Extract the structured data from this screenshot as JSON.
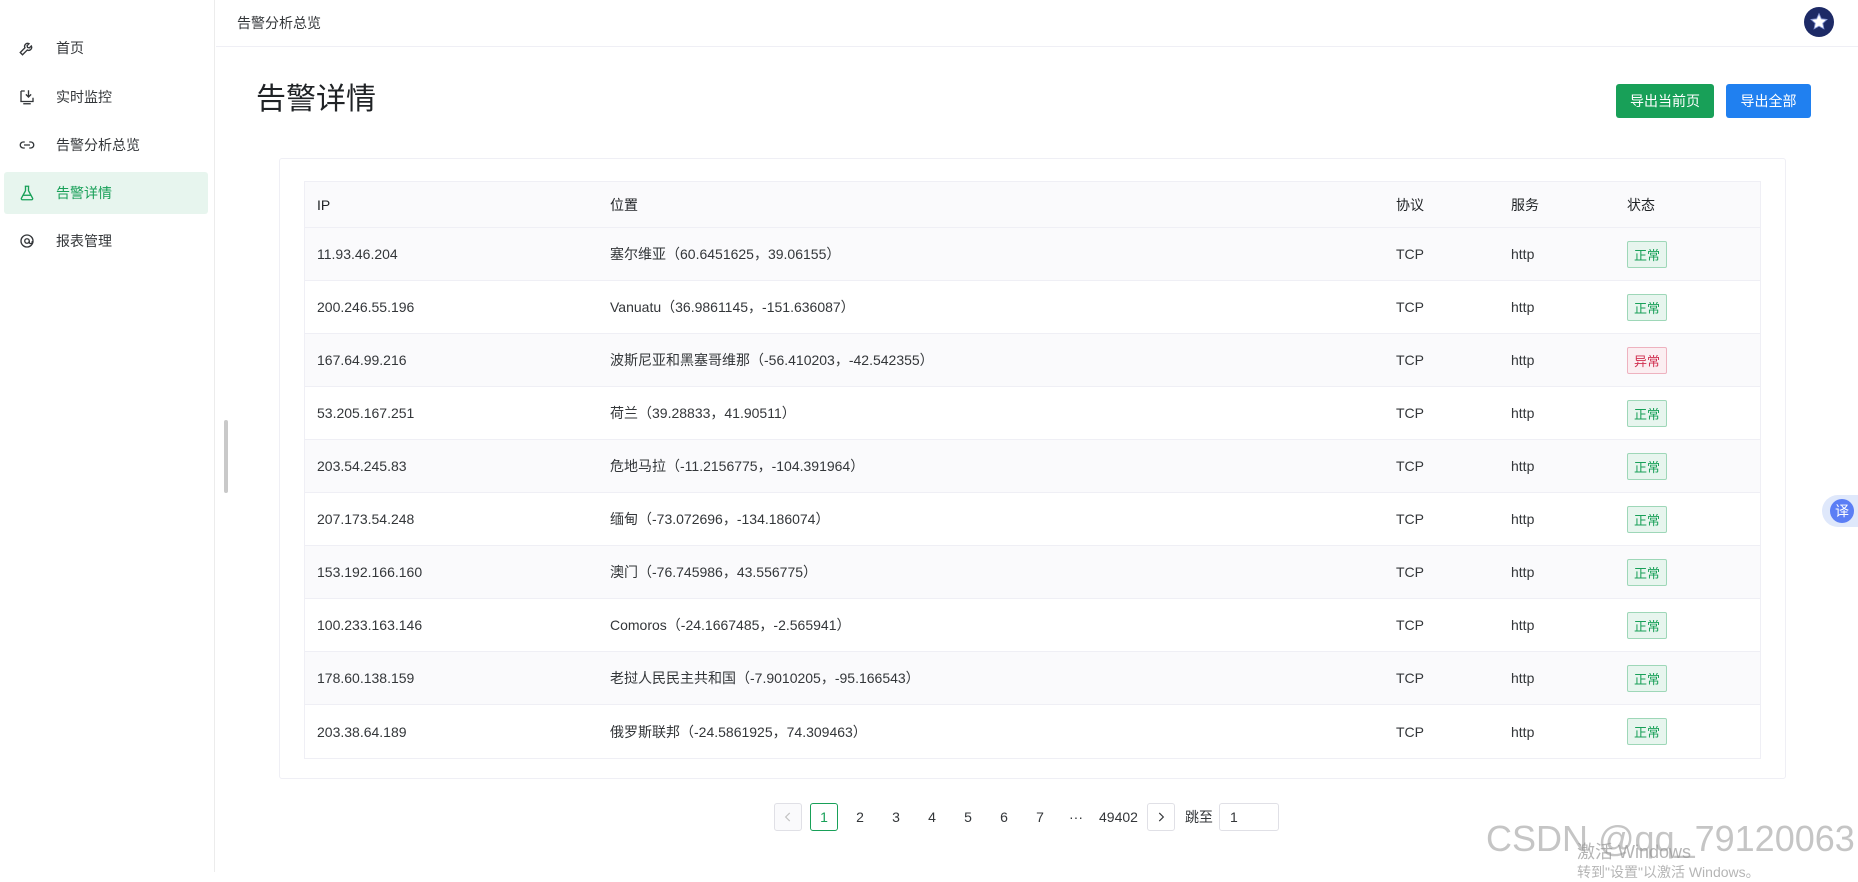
{
  "sidebar": {
    "items": [
      {
        "label": "首页",
        "icon": "wrench-icon"
      },
      {
        "label": "实时监控",
        "icon": "download-monitor-icon"
      },
      {
        "label": "告警分析总览",
        "icon": "link-icon"
      },
      {
        "label": "告警详情",
        "icon": "flask-icon",
        "active": true
      },
      {
        "label": "报表管理",
        "icon": "search-at-icon"
      }
    ]
  },
  "header": {
    "breadcrumb": "告警分析总览"
  },
  "page": {
    "title": "告警详情",
    "export_current_label": "导出当前页",
    "export_all_label": "导出全部"
  },
  "table": {
    "columns": [
      "IP",
      "位置",
      "协议",
      "服务",
      "状态"
    ],
    "rows": [
      {
        "ip": "11.93.46.204",
        "location": "塞尔维亚（60.6451625，39.06155）",
        "protocol": "TCP",
        "service": "http",
        "status": "正常",
        "status_type": "ok"
      },
      {
        "ip": "200.246.55.196",
        "location": "Vanuatu（36.9861145，-151.636087）",
        "protocol": "TCP",
        "service": "http",
        "status": "正常",
        "status_type": "ok"
      },
      {
        "ip": "167.64.99.216",
        "location": "波斯尼亚和黑塞哥维那（-56.410203，-42.542355）",
        "protocol": "TCP",
        "service": "http",
        "status": "异常",
        "status_type": "err"
      },
      {
        "ip": "53.205.167.251",
        "location": "荷兰（39.28833，41.90511）",
        "protocol": "TCP",
        "service": "http",
        "status": "正常",
        "status_type": "ok"
      },
      {
        "ip": "203.54.245.83",
        "location": "危地马拉（-11.2156775，-104.391964）",
        "protocol": "TCP",
        "service": "http",
        "status": "正常",
        "status_type": "ok"
      },
      {
        "ip": "207.173.54.248",
        "location": "缅甸（-73.072696，-134.186074）",
        "protocol": "TCP",
        "service": "http",
        "status": "正常",
        "status_type": "ok"
      },
      {
        "ip": "153.192.166.160",
        "location": "澳门（-76.745986，43.556775）",
        "protocol": "TCP",
        "service": "http",
        "status": "正常",
        "status_type": "ok"
      },
      {
        "ip": "100.233.163.146",
        "location": "Comoros（-24.1667485，-2.565941）",
        "protocol": "TCP",
        "service": "http",
        "status": "正常",
        "status_type": "ok"
      },
      {
        "ip": "178.60.138.159",
        "location": "老挝人民民主共和国（-7.9010205，-95.166543）",
        "protocol": "TCP",
        "service": "http",
        "status": "正常",
        "status_type": "ok"
      },
      {
        "ip": "203.38.64.189",
        "location": "俄罗斯联邦（-24.5861925，74.309463）",
        "protocol": "TCP",
        "service": "http",
        "status": "正常",
        "status_type": "ok"
      }
    ]
  },
  "pagination": {
    "prev_icon": "chevron-left-icon",
    "pages": [
      "1",
      "2",
      "3",
      "4",
      "5",
      "6",
      "7",
      "···",
      "49402"
    ],
    "current": "1",
    "next_icon": "chevron-right-icon",
    "jump_label": "跳至",
    "jump_value": "1"
  },
  "overlay": {
    "translate_label": "译",
    "watermark": "CSDN @qq_79120063",
    "windows_line1": "激活 Windows",
    "windows_line2": "转到\"设置\"以激活 Windows。"
  },
  "colors": {
    "accent_green": "#18a058",
    "accent_blue": "#2080f0",
    "error_red": "#d03050"
  }
}
